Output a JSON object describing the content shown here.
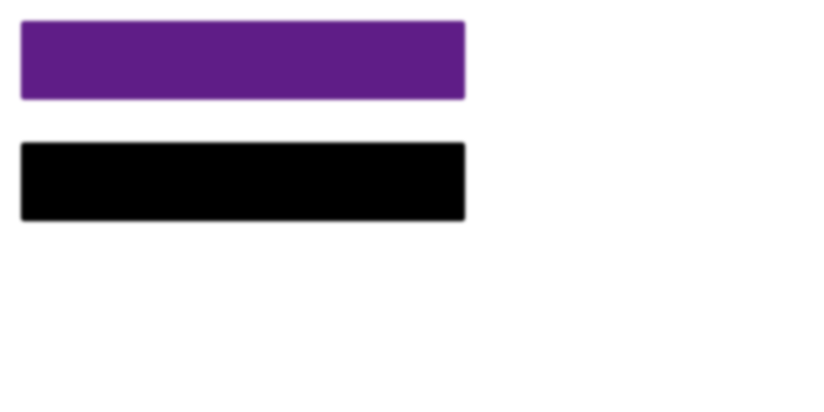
{
  "swatches": [
    {
      "color": "#5f1d87"
    },
    {
      "color": "#000000"
    }
  ]
}
